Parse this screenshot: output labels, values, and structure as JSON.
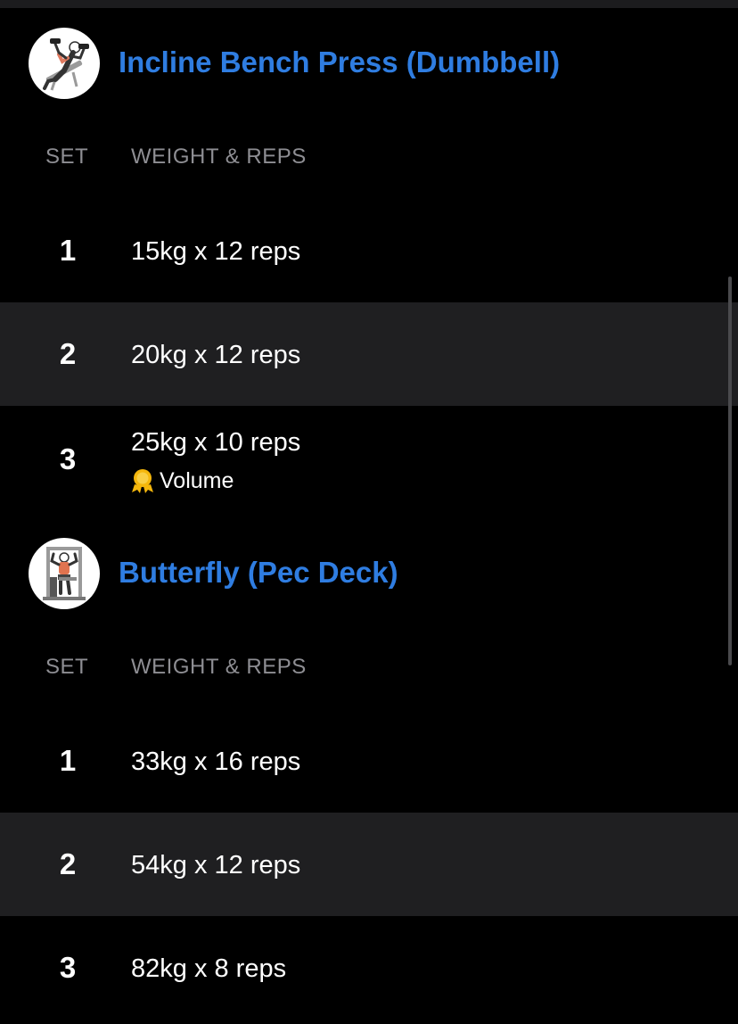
{
  "exercises": [
    {
      "title": "Incline Bench Press (Dumbbell)",
      "thumbnail_icon": "incline-dumbbell-press-illustration",
      "columns": {
        "set": "SET",
        "weight_reps": "WEIGHT & REPS"
      },
      "sets": [
        {
          "number": "1",
          "value": "15kg x 12 reps",
          "highlighted": false
        },
        {
          "number": "2",
          "value": "20kg x 12 reps",
          "highlighted": true
        },
        {
          "number": "3",
          "value": "25kg x 10 reps",
          "highlighted": false,
          "badge": {
            "icon": "medal-icon",
            "label": "Volume"
          }
        }
      ]
    },
    {
      "title": "Butterfly (Pec Deck)",
      "thumbnail_icon": "pec-deck-machine-illustration",
      "columns": {
        "set": "SET",
        "weight_reps": "WEIGHT & REPS"
      },
      "sets": [
        {
          "number": "1",
          "value": "33kg x 16 reps",
          "highlighted": false
        },
        {
          "number": "2",
          "value": "54kg x 12 reps",
          "highlighted": true
        },
        {
          "number": "3",
          "value": "82kg x 8 reps",
          "highlighted": false
        }
      ]
    }
  ],
  "colors": {
    "background": "#000000",
    "accent": "#2f7de1",
    "row_highlight": "#1f1f21",
    "muted_text": "#8e8e93",
    "medal": "#f5b70c"
  }
}
